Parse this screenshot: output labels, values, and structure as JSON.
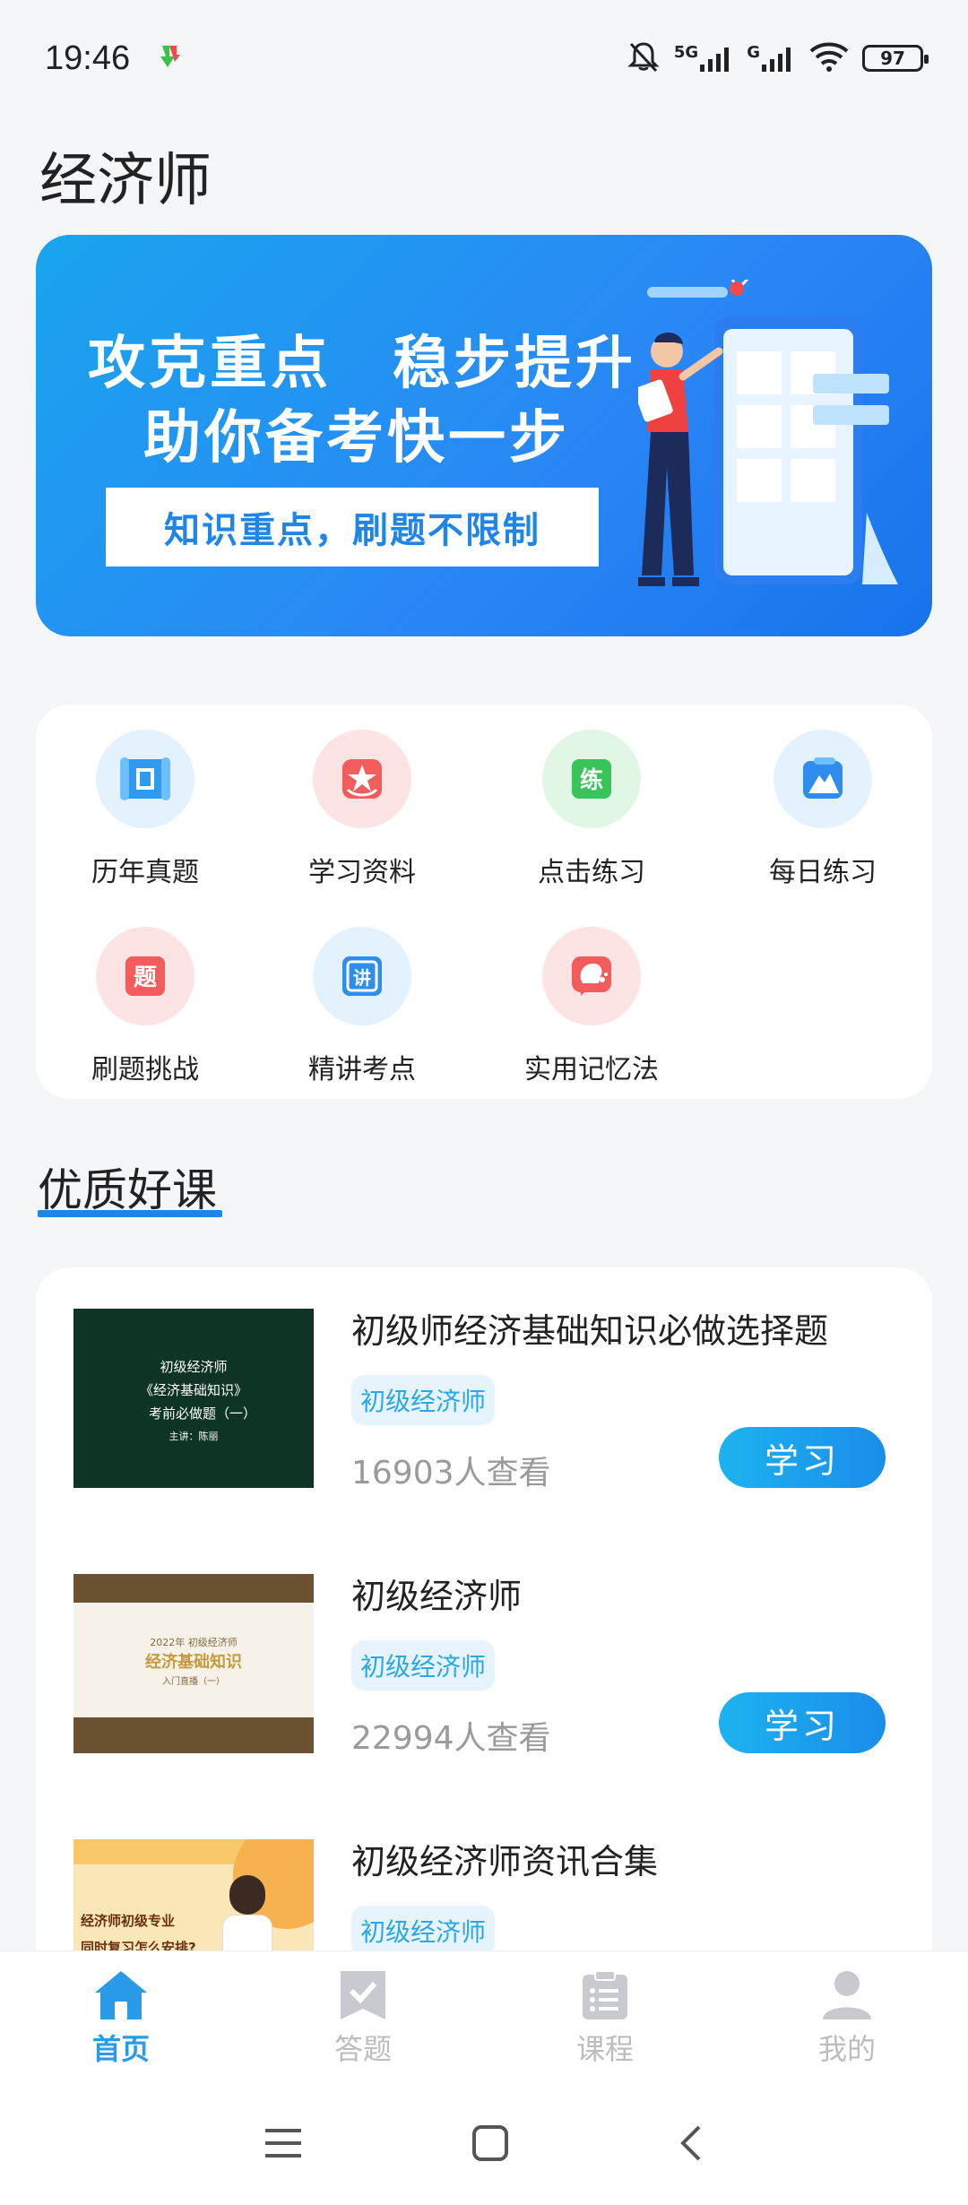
{
  "status_bar": {
    "time": "19:46",
    "network_1": "5G",
    "network_2": "G",
    "battery": "97"
  },
  "header": {
    "title": "经济师"
  },
  "banner": {
    "line1": "攻克重点　稳步提升",
    "line2": "助你备考快一步",
    "box_text": "知识重点，刷题不限制"
  },
  "grid": {
    "items": [
      {
        "label": "历年真题",
        "icon": "scroll-icon",
        "glyph": "口"
      },
      {
        "label": "学习资料",
        "icon": "star-book-icon",
        "glyph": "★"
      },
      {
        "label": "点击练习",
        "icon": "practice-icon",
        "glyph": "练"
      },
      {
        "label": "每日练习",
        "icon": "mountain-icon",
        "glyph": "▲"
      },
      {
        "label": "刷题挑战",
        "icon": "question-icon",
        "glyph": "题"
      },
      {
        "label": "精讲考点",
        "icon": "lecture-icon",
        "glyph": "讲"
      },
      {
        "label": "实用记忆法",
        "icon": "brain-head-icon",
        "glyph": "●"
      }
    ]
  },
  "section": {
    "title": "优质好课"
  },
  "courses": [
    {
      "title": "初级师经济基础知识必做选择题",
      "tag": "初级经济师",
      "views": "16903人查看",
      "button": "学习",
      "thumb_lines": [
        "初级经济师",
        "《经济基础知识》",
        "考前必做题（一）",
        "主讲：陈丽"
      ]
    },
    {
      "title": "初级经济师",
      "tag": "初级经济师",
      "views": "22994人查看",
      "button": "学习",
      "thumb_lines": [
        "2022年",
        "初级经济师",
        "经济基础知识",
        "入门直播（一）"
      ]
    },
    {
      "title": "初级经济师资讯合集",
      "tag": "初级经济师",
      "thumb_lines": [
        "经济师初级专业",
        "同时复习怎么安排?"
      ]
    }
  ],
  "bottom_nav": {
    "items": [
      {
        "label": "首页",
        "icon": "home-icon",
        "active": true
      },
      {
        "label": "答题",
        "icon": "answer-icon",
        "active": false
      },
      {
        "label": "课程",
        "icon": "course-icon",
        "active": false
      },
      {
        "label": "我的",
        "icon": "profile-icon",
        "active": false
      }
    ]
  },
  "colors": {
    "accent": "#1f86e8",
    "banner_start": "#19a5ee",
    "banner_end": "#1773ea",
    "tag_bg": "#e7f4fd",
    "tag_text": "#2aa7e9"
  }
}
